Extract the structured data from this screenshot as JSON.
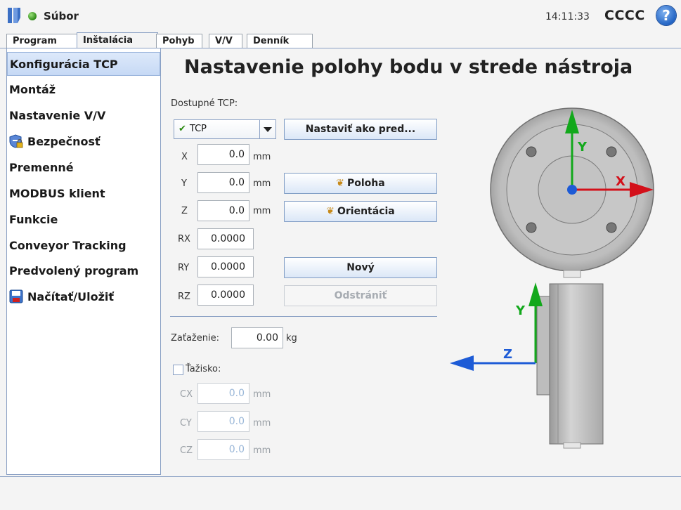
{
  "header": {
    "file_menu": "Súbor",
    "time": "14:11:33",
    "robot_name": "CCCC",
    "help": "?"
  },
  "tabs": [
    {
      "label": "Program"
    },
    {
      "label": "Inštalácia",
      "active": true
    },
    {
      "label": "Pohyb"
    },
    {
      "label": "V/V"
    },
    {
      "label": "Denník"
    }
  ],
  "sidebar": {
    "items": [
      {
        "label": "Konfigurácia TCP",
        "selected": true
      },
      {
        "label": "Montáž"
      },
      {
        "label": "Nastavenie V/V"
      },
      {
        "label": "Bezpečnosť",
        "icon": "shield-lock-icon"
      },
      {
        "label": "Premenné"
      },
      {
        "label": "MODBUS klient"
      },
      {
        "label": "Funkcie"
      },
      {
        "label": "Conveyor Tracking"
      },
      {
        "label": "Predvolený program"
      },
      {
        "label": "Načítať/Uložiť",
        "icon": "floppy-disk-icon"
      }
    ]
  },
  "main": {
    "title": "Nastavenie polohy bodu v strede nástroja",
    "available_tcp_label": "Dostupné TCP:",
    "tcp_selected": "TCP",
    "set_default_button": "Nastaviť ako pred...",
    "position_button": "Poloha",
    "orientation_button": "Orientácia",
    "new_button": "Nový",
    "remove_button": "Odstrániť",
    "unit_mm": "mm",
    "unit_kg": "kg",
    "coords": [
      {
        "label": "X",
        "value": "0.0",
        "unit": "mm"
      },
      {
        "label": "Y",
        "value": "0.0",
        "unit": "mm"
      },
      {
        "label": "Z",
        "value": "0.0",
        "unit": "mm"
      },
      {
        "label": "RX",
        "value": "0.0000"
      },
      {
        "label": "RY",
        "value": "0.0000"
      },
      {
        "label": "RZ",
        "value": "0.0000"
      }
    ],
    "payload_label": "Zaťaženie:",
    "payload_value": "0.00",
    "cog_label": "Ťažisko:",
    "cog_checked": false,
    "cog": [
      {
        "label": "CX",
        "value": "0.0"
      },
      {
        "label": "CY",
        "value": "0.0"
      },
      {
        "label": "CZ",
        "value": "0.0"
      }
    ]
  },
  "diagram": {
    "top_axes": {
      "x": "X",
      "y": "Y"
    },
    "side_axes": {
      "y": "Y",
      "z": "Z"
    },
    "colors": {
      "x_axis": "#d3101a",
      "y_axis": "#12a81b",
      "z_axis": "#1d5bd6"
    }
  }
}
